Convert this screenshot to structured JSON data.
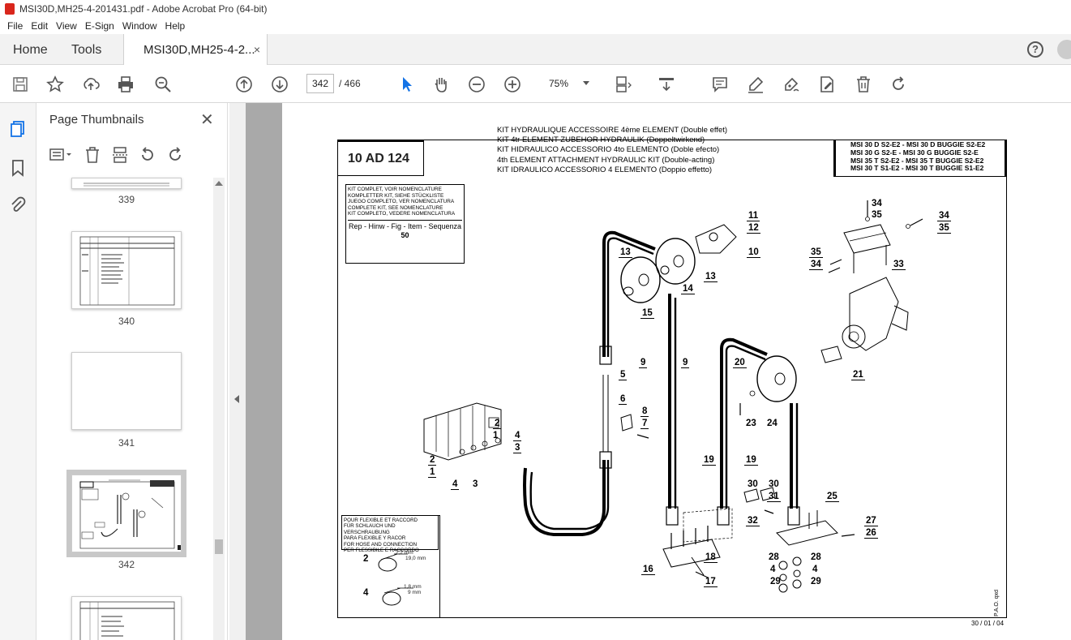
{
  "window": {
    "title": "MSI30D,MH25-4-201431.pdf - Adobe Acrobat Pro (64-bit)"
  },
  "menu": {
    "items": [
      "File",
      "Edit",
      "View",
      "E-Sign",
      "Window",
      "Help"
    ]
  },
  "tabs": {
    "home": "Home",
    "tools": "Tools",
    "document": "MSI30D,MH25-4-2...",
    "close": "×",
    "help": "?"
  },
  "toolbar": {
    "current_page": "342",
    "total_pages": "/ 466",
    "zoom": "75%",
    "icons": [
      "save-icon",
      "bookmark-star-icon",
      "upload-icon",
      "print-icon",
      "zoom-search-icon",
      "prev-page-icon",
      "next-page-icon",
      "select-arrow-icon",
      "hand-icon",
      "zoom-out-icon",
      "zoom-in-icon",
      "fit-page-icon",
      "scroll-mode-icon",
      "comment-icon",
      "highlight-icon",
      "sign-icon",
      "edit-pdf-icon",
      "delete-icon",
      "rotate-icon"
    ]
  },
  "panel": {
    "title": "Page Thumbnails",
    "close": "✕",
    "thumbnails": [
      {
        "label": "339"
      },
      {
        "label": "340"
      },
      {
        "label": "341"
      },
      {
        "label": "342",
        "selected": true
      }
    ]
  },
  "document": {
    "code": "10 AD 124",
    "titles": [
      "KIT HYDRAULIQUE ACCESSOIRE 4ème ELEMENT (Double effet)",
      "KIT 4tr ELEMENT ZUBEHOR HYDRAULIK (Doppeltwirkend)",
      "KIT HIDRAULICO ACCESSORIO 4to ELEMENTO (Doble efecto)",
      "4th ELEMENT ATTACHMENT HYDRAULIC KIT (Double-acting)",
      "KIT IDRAULICO ACCESSORIO 4 ELEMENTO (Doppio effetto)"
    ],
    "models": [
      "MSI 30 D S2-E2 - MSI 30 D BUGGIE S2-E2",
      "MSI 30 G S2-E - MSI 30 G BUGGIE S2-E",
      "MSI 35 T S2-E2 - MSI 35 T BUGGIE S2-E2",
      "MSI 30 T S1-E2 - MSI 30 T BUGGIE S1-E2"
    ],
    "kit_note": [
      "KIT COMPLET, VOIR NOMENCLATURE",
      "KOMPLETTER KIT, SIEHE STÜCKLISTE",
      "JUEGO COMPLETO, VER NOMENCLATURA",
      "COMPLETE KIT, SEE NOMENCLATURE",
      "KIT COMPLETO, VEDERE NOMENCLATURA"
    ],
    "ref_header": "Rep - Hinw - Fig - Item - Sequenza",
    "ref_value": "50",
    "hose_note": [
      "POUR FLEXIBLE ET RACCORD",
      "FÜR SCHLAUCH UND VERSCHRAUBUNG",
      "PARA FLEXIBLE Y RACOR",
      "FOR HOSE AND CONNECTION",
      "PER FLESSIBILE E RACCORDO"
    ],
    "hose_details": [
      {
        "item": "2",
        "dim1": "2,2 mm",
        "dim2": "19,0 mm"
      },
      {
        "item": "4",
        "dim1": "1,8 mm",
        "dim2": "9 mm"
      }
    ],
    "side_code": "P.A.O. qxd",
    "page_date": "30 / 01 / 04",
    "callouts": [
      "11",
      "12",
      "10",
      "13",
      "13",
      "14",
      "15",
      "34",
      "35",
      "34",
      "35",
      "35",
      "34",
      "33",
      "9",
      "9",
      "5",
      "6",
      "8",
      "7",
      "2",
      "4",
      "1",
      "3",
      "2",
      "1",
      "4",
      "3",
      "20",
      "21",
      "23",
      "24",
      "19",
      "19",
      "30",
      "30",
      "31",
      "32",
      "25",
      "27",
      "26",
      "16",
      "18",
      "17",
      "28",
      "28",
      "4",
      "4",
      "29",
      "29"
    ]
  }
}
